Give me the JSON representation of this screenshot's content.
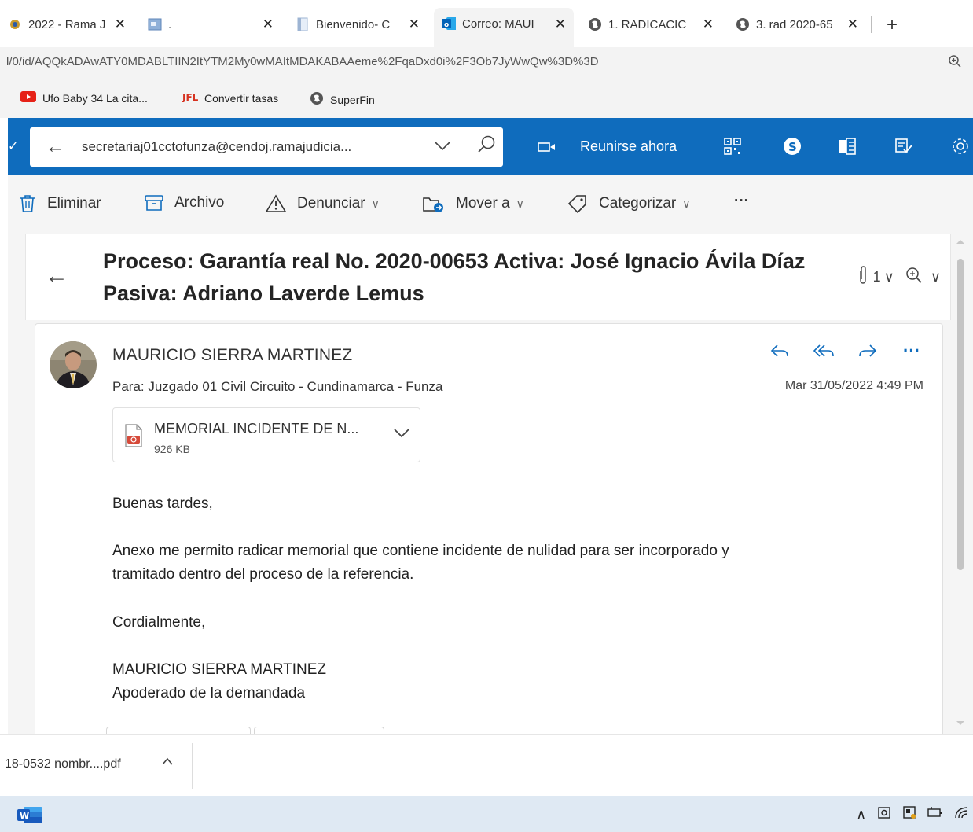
{
  "browser": {
    "tabs": [
      {
        "label": "2022 - Rama J"
      },
      {
        "label": "."
      },
      {
        "label": "Bienvenido- C"
      },
      {
        "label": "Correo: MAUI"
      },
      {
        "label": "1. RADICACIC"
      },
      {
        "label": "3. rad 2020-65"
      }
    ],
    "new_tab": "+",
    "url": "l/0/id/AQQkADAwATY0MDABLTIIN2ItYTM2My0wMAItMDAKABAAeme%2FqaDxd0i%2F3Ob7JyWwQw%3D%3D",
    "bookmarks": [
      {
        "label": "Ufo Baby 34 La cita..."
      },
      {
        "label": "Convertir tasas"
      },
      {
        "label": "SuperFin"
      }
    ]
  },
  "header": {
    "search_value": "secretariaj01cctofunza@cendoj.ramajudicia...",
    "meet_label": "Reunirse ahora"
  },
  "toolbar": {
    "delete": "Eliminar",
    "archive": "Archivo",
    "report": "Denunciar",
    "move": "Mover a",
    "categorize": "Categorizar",
    "more": "···"
  },
  "email": {
    "subject": "Proceso: Garantía real No. 2020-00653 Activa: José Ignacio Ávila Díaz Pasiva: Adriano Laverde Lemus",
    "attachment_count": "1",
    "sender": "MAURICIO SIERRA MARTINEZ",
    "to": "Para: Juzgado 01 Civil Circuito - Cundinamarca - Funza",
    "date": "Mar 31/05/2022 4:49 PM",
    "more_actions": "···",
    "attachment": {
      "name": "MEMORIAL INCIDENTE DE N...",
      "size": "926 KB"
    },
    "body": {
      "greeting": "Buenas tardes,",
      "paragraph_line1": "Anexo me permito radicar memorial que contiene incidente de nulidad para ser incorporado y",
      "paragraph_line2": "tramitado dentro del proceso de la referencia.",
      "closing": "Cordialmente,",
      "signature_name": "MAURICIO SIERRA MARTINEZ",
      "signature_role": "Apoderado de la demandada"
    }
  },
  "downloads": {
    "file": "18-0532 nombr....pdf"
  },
  "colors": {
    "outlook_blue": "#0f6cbd",
    "taskbar": "#dfe9f3"
  }
}
